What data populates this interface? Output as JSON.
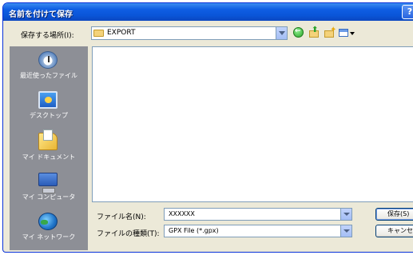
{
  "window": {
    "title": "名前を付けて保存",
    "help_label": "?"
  },
  "toolbar": {
    "save_in_label": "保存する場所(I):",
    "location_value": "EXPORT",
    "back_icon": "back-arrow-icon",
    "up_icon": "up-folder-icon",
    "new_folder_icon": "new-folder-icon",
    "views_icon": "views-menu-icon"
  },
  "places": [
    {
      "label": "最近使ったファイル",
      "icon": "recent-documents-icon"
    },
    {
      "label": "デスクトップ",
      "icon": "desktop-icon"
    },
    {
      "label": "マイ ドキュメント",
      "icon": "my-documents-icon"
    },
    {
      "label": "マイ コンピュータ",
      "icon": "my-computer-icon"
    },
    {
      "label": "マイ ネットワーク",
      "icon": "my-network-icon"
    }
  ],
  "form": {
    "filename_label": "ファイル名(N):",
    "filename_value": "XXXXXX",
    "filetype_label": "ファイルの種類(T):",
    "filetype_value": "GPX File (*.gpx)"
  },
  "buttons": {
    "save_label": "保存(S)",
    "cancel_label": "キャンセル"
  }
}
